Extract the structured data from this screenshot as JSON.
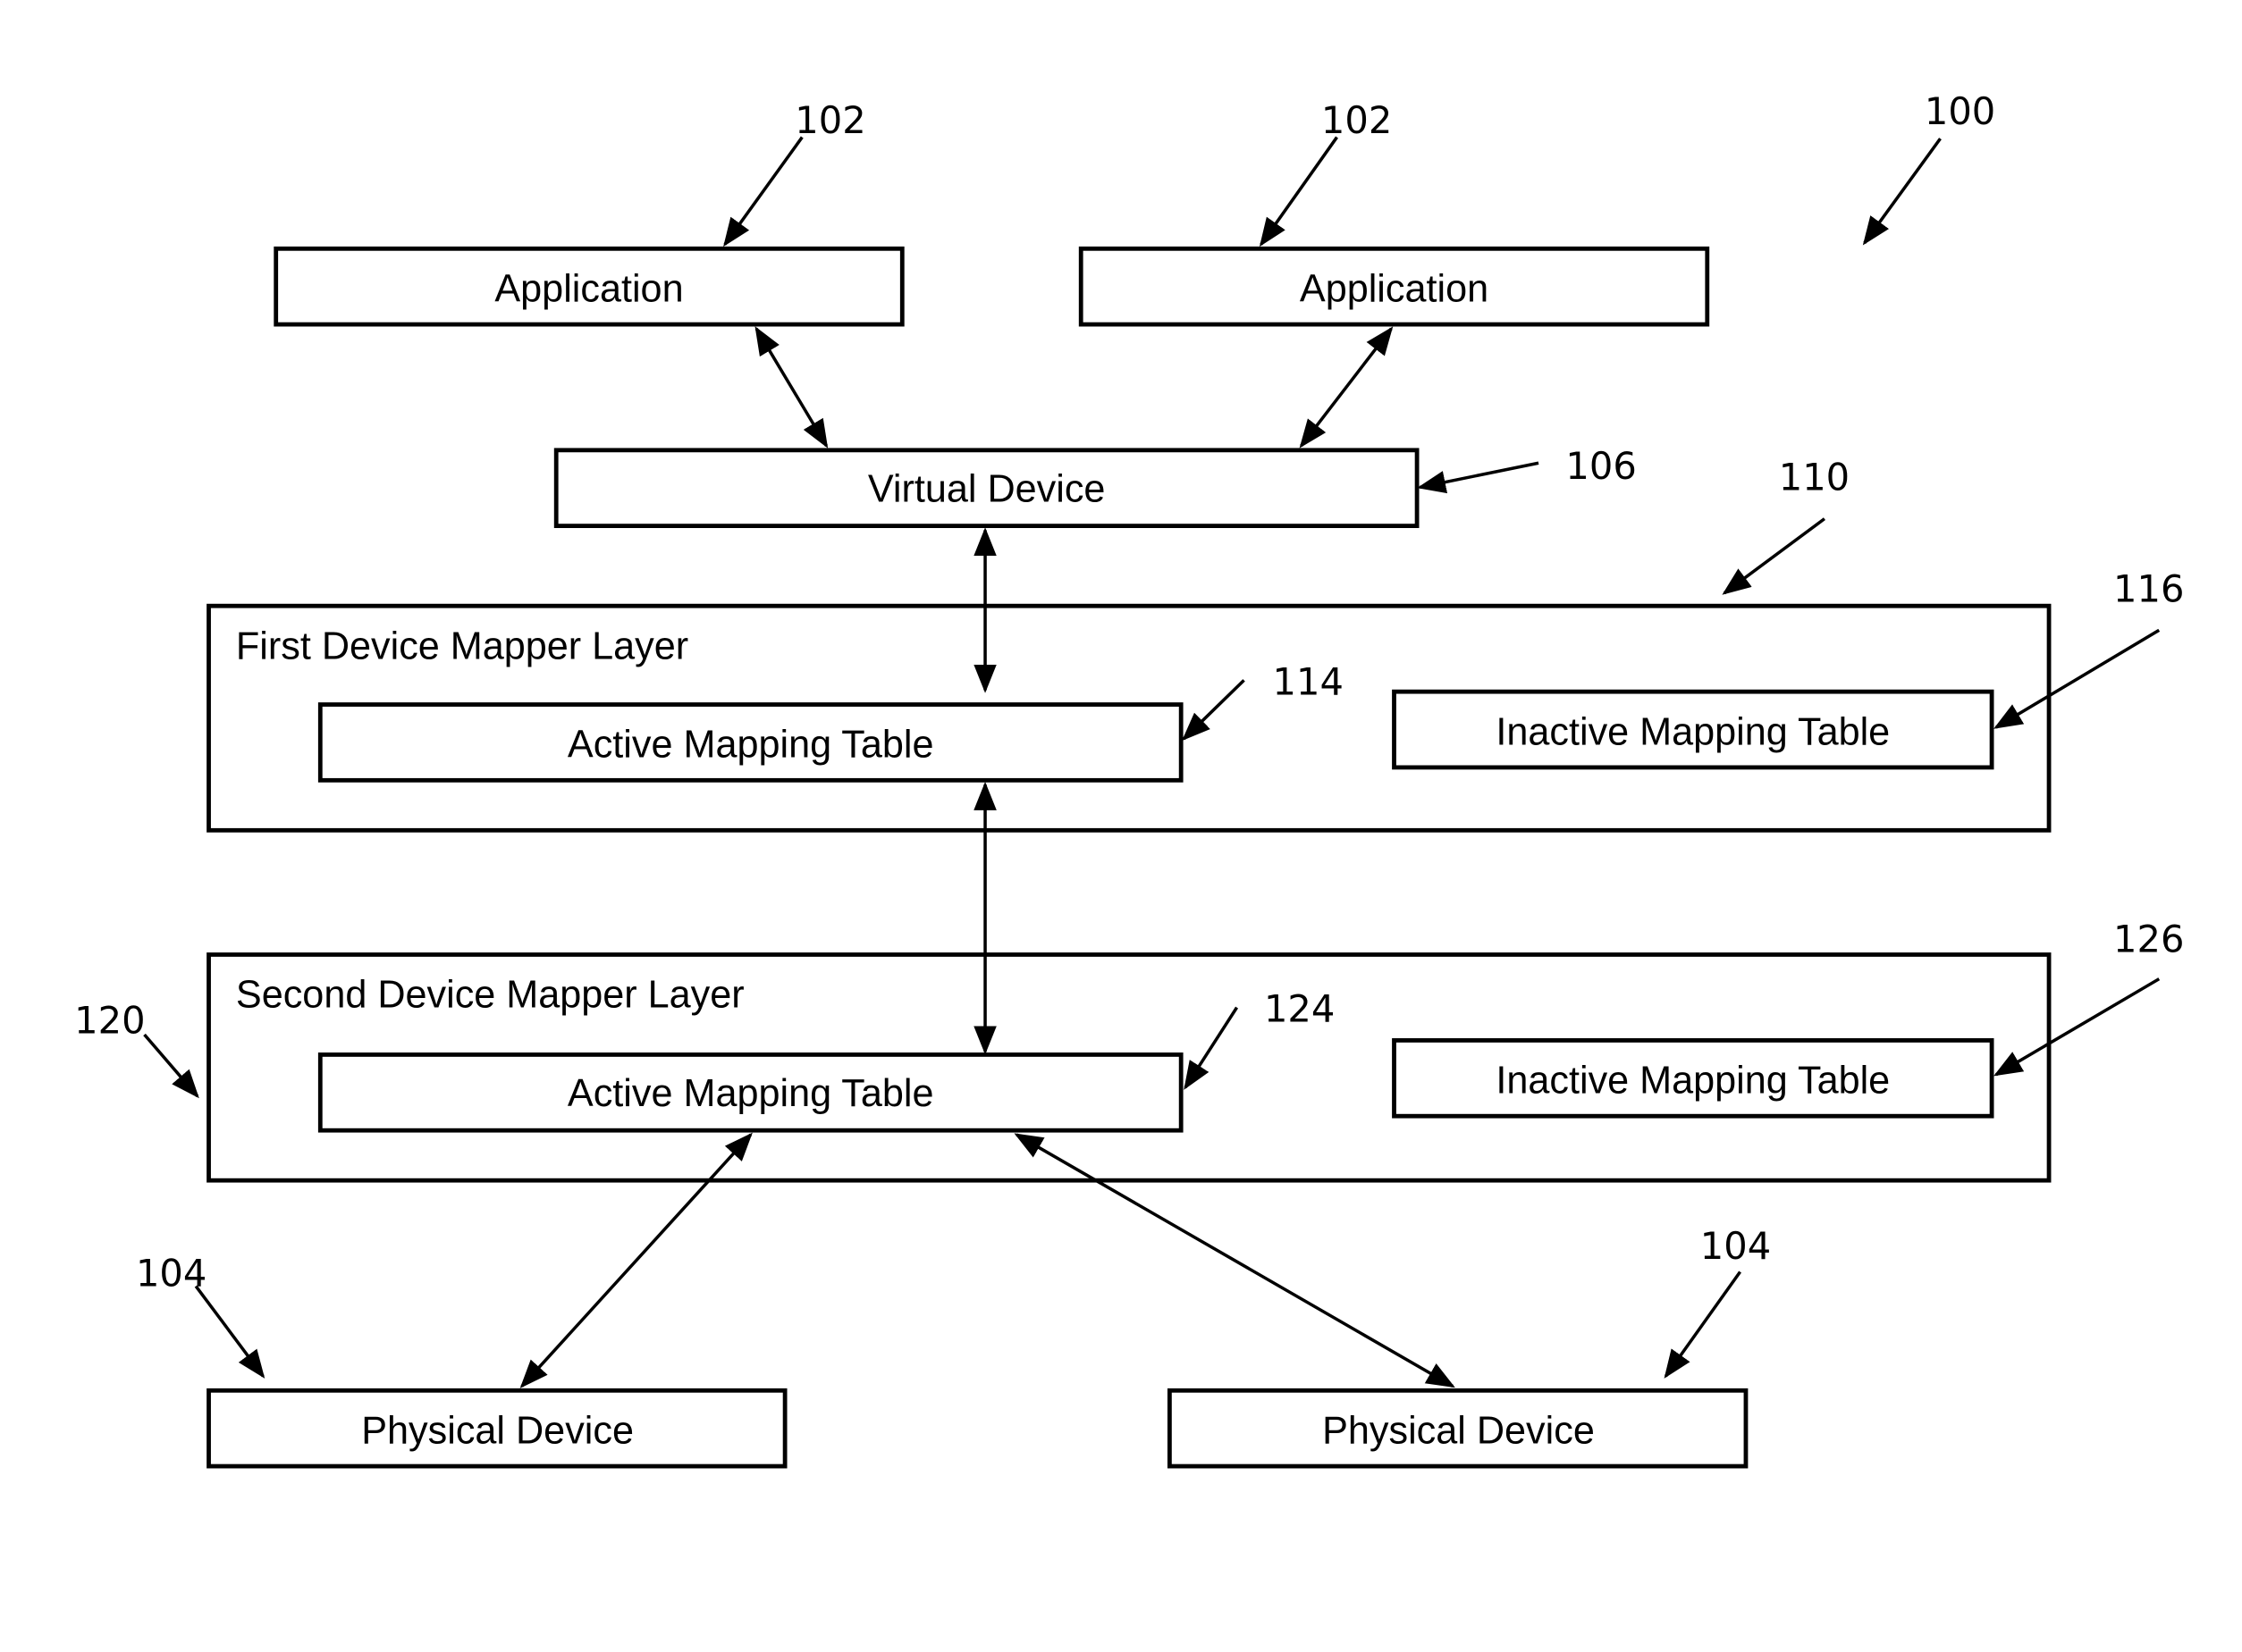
{
  "figure": {
    "ref": "100",
    "applications": [
      {
        "label": "Application",
        "ref": "102"
      },
      {
        "label": "Application",
        "ref": "102"
      }
    ],
    "virtual_device": {
      "label": "Virtual Device",
      "ref": "106"
    },
    "first_layer": {
      "label": "First Device Mapper Layer",
      "ref": "110",
      "active_table": {
        "label": "Active Mapping Table",
        "ref": "114"
      },
      "inactive_table": {
        "label": "Inactive Mapping Table",
        "ref": "116"
      }
    },
    "second_layer": {
      "label": "Second Device Mapper Layer",
      "ref": "120",
      "active_table": {
        "label": "Active Mapping Table",
        "ref": "124"
      },
      "inactive_table": {
        "label": "Inactive Mapping Table",
        "ref": "126"
      }
    },
    "physical_devices": [
      {
        "label": "Physical Device",
        "ref": "104"
      },
      {
        "label": "Physical Device",
        "ref": "104"
      }
    ]
  }
}
